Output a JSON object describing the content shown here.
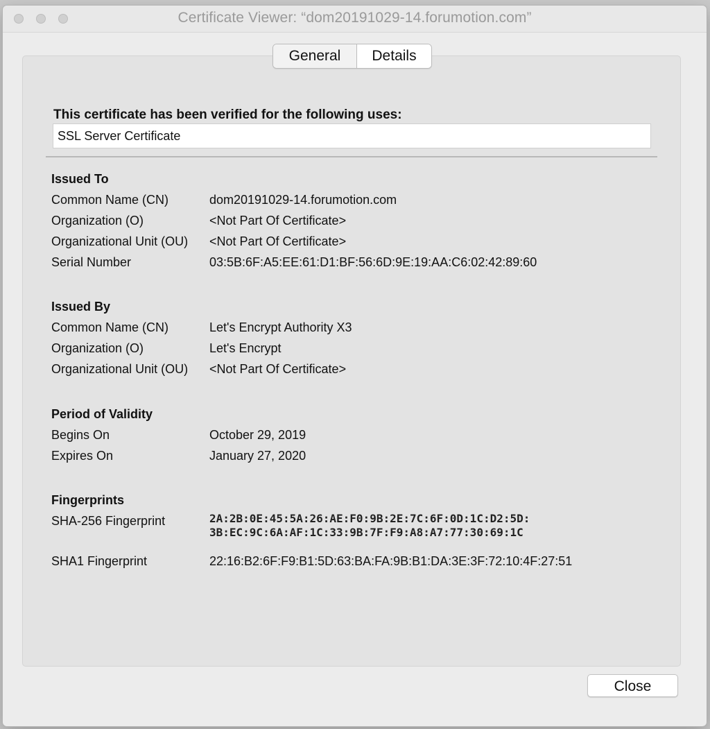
{
  "window": {
    "title": "Certificate Viewer: “dom20191029-14.forumotion.com”"
  },
  "tabs": [
    {
      "label": "General"
    },
    {
      "label": "Details"
    }
  ],
  "uses": {
    "heading": "This certificate has been verified for the following uses:",
    "value": "SSL Server Certificate"
  },
  "issued_to": {
    "title": "Issued To",
    "rows": [
      {
        "label": "Common Name (CN)",
        "value": "dom20191029-14.forumotion.com"
      },
      {
        "label": "Organization (O)",
        "value": "<Not Part Of Certificate>"
      },
      {
        "label": "Organizational Unit (OU)",
        "value": "<Not Part Of Certificate>"
      },
      {
        "label": "Serial Number",
        "value": "03:5B:6F:A5:EE:61:D1:BF:56:6D:9E:19:AA:C6:02:42:89:60"
      }
    ]
  },
  "issued_by": {
    "title": "Issued By",
    "rows": [
      {
        "label": "Common Name (CN)",
        "value": "Let's Encrypt Authority X3"
      },
      {
        "label": "Organization (O)",
        "value": "Let's Encrypt"
      },
      {
        "label": "Organizational Unit (OU)",
        "value": "<Not Part Of Certificate>"
      }
    ]
  },
  "validity": {
    "title": "Period of Validity",
    "rows": [
      {
        "label": "Begins On",
        "value": "October 29, 2019"
      },
      {
        "label": "Expires On",
        "value": "January 27, 2020"
      }
    ]
  },
  "fingerprints": {
    "title": "Fingerprints",
    "sha256": {
      "label": "SHA-256 Fingerprint",
      "line1": "2A:2B:0E:45:5A:26:AE:F0:9B:2E:7C:6F:0D:1C:D2:5D:",
      "line2": "3B:EC:9C:6A:AF:1C:33:9B:7F:F9:A8:A7:77:30:69:1C"
    },
    "sha1": {
      "label": "SHA1 Fingerprint",
      "value": "22:16:B2:6F:F9:B1:5D:63:BA:FA:9B:B1:DA:3E:3F:72:10:4F:27:51"
    }
  },
  "buttons": {
    "close_label": "Close"
  }
}
